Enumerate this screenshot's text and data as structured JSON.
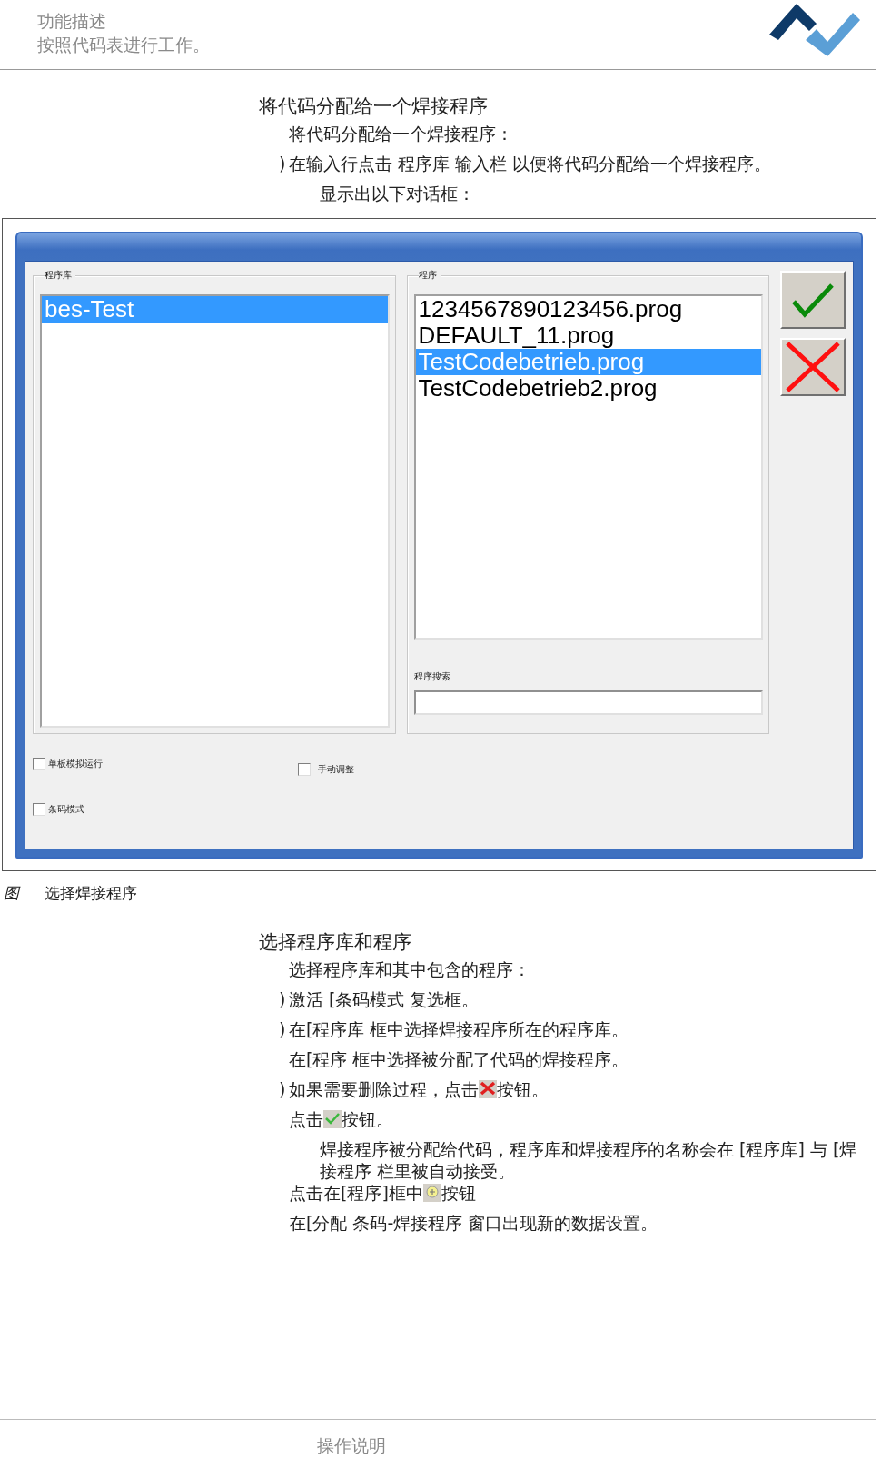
{
  "header": {
    "lines": [
      "功能描述",
      "按照代码表进行工作。"
    ]
  },
  "section_1": {
    "heading": "将代码分配给一个焊接程序",
    "paragraphs": [
      {
        "kind": "intro",
        "parts": [
          {
            "kind": "text",
            "text": "将代码分配给一个焊接程序："
          }
        ]
      },
      {
        "kind": "step",
        "marker": ")",
        "parts": [
          {
            "kind": "text",
            "text": "在输入行点击  程序库  输入栏 以便将代码分配给一个焊接程序。"
          }
        ]
      },
      {
        "kind": "result",
        "parts": [
          {
            "kind": "text",
            "text": "显示出以下对话框："
          }
        ]
      }
    ]
  },
  "dialog": {
    "library_group": {
      "label": "程序库",
      "items": [
        {
          "text": "bes-Test",
          "selected": true
        }
      ]
    },
    "program_group": {
      "label": "程序",
      "items": [
        {
          "text": "1234567890123456.prog",
          "selected": false
        },
        {
          "text": "DEFAULT_11.prog",
          "selected": false
        },
        {
          "text": "TestCodebetrieb.prog",
          "selected": true
        },
        {
          "text": "TestCodebetrieb2.prog",
          "selected": false
        }
      ],
      "search_label": "程序搜索"
    },
    "checkboxes": [
      {
        "label": "单板模拟运行",
        "checked": false
      },
      {
        "label": "手动调整",
        "checked": false
      },
      {
        "label": "条码模式",
        "checked": false
      }
    ]
  },
  "caption": {
    "label": "图",
    "text": "选择焊接程序"
  },
  "section_2": {
    "heading": "选择程序库和程序",
    "paragraphs": [
      {
        "kind": "intro",
        "parts": [
          {
            "kind": "text",
            "text": "选择程序库和其中包含的程序："
          }
        ]
      },
      {
        "kind": "step",
        "marker": ")",
        "parts": [
          {
            "kind": "text",
            "text": "激活 [条码模式  复选框。"
          }
        ]
      },
      {
        "kind": "step",
        "marker": ")",
        "parts": [
          {
            "kind": "text",
            "text": "在[程序库  框中选择焊接程序所在的程序库。"
          }
        ]
      },
      {
        "kind": "intro",
        "parts": [
          {
            "kind": "text",
            "text": "在[程序  框中选择被分配了代码的焊接程序。"
          }
        ]
      },
      {
        "kind": "step",
        "marker": ")",
        "parts": [
          {
            "kind": "text",
            "text": "如果需要删除过程，点击"
          },
          {
            "kind": "cancel"
          },
          {
            "kind": "text",
            "text": "按钮。"
          }
        ]
      },
      {
        "kind": "intro",
        "parts": [
          {
            "kind": "text",
            "text": "点击"
          },
          {
            "kind": "confirm"
          },
          {
            "kind": "text",
            "text": "按钮。"
          }
        ]
      },
      {
        "kind": "result",
        "parts": [
          {
            "kind": "text",
            "text": "焊接程序被分配给代码，程序库和焊接程序的名称会在 [程序库] 与 [焊接程序  栏里被自动接受。"
          }
        ]
      },
      {
        "kind": "intro",
        "parts": [
          {
            "kind": "text",
            "text": "点击在[程序]框中"
          },
          {
            "kind": "add"
          },
          {
            "kind": "text",
            "text": "按钮"
          }
        ]
      },
      {
        "kind": "intro",
        "parts": [
          {
            "kind": "text",
            "text": "在[分配  条码-焊接程序  窗口出现新的数据设置。"
          }
        ]
      }
    ]
  },
  "footer": {
    "text": "操作说明"
  }
}
